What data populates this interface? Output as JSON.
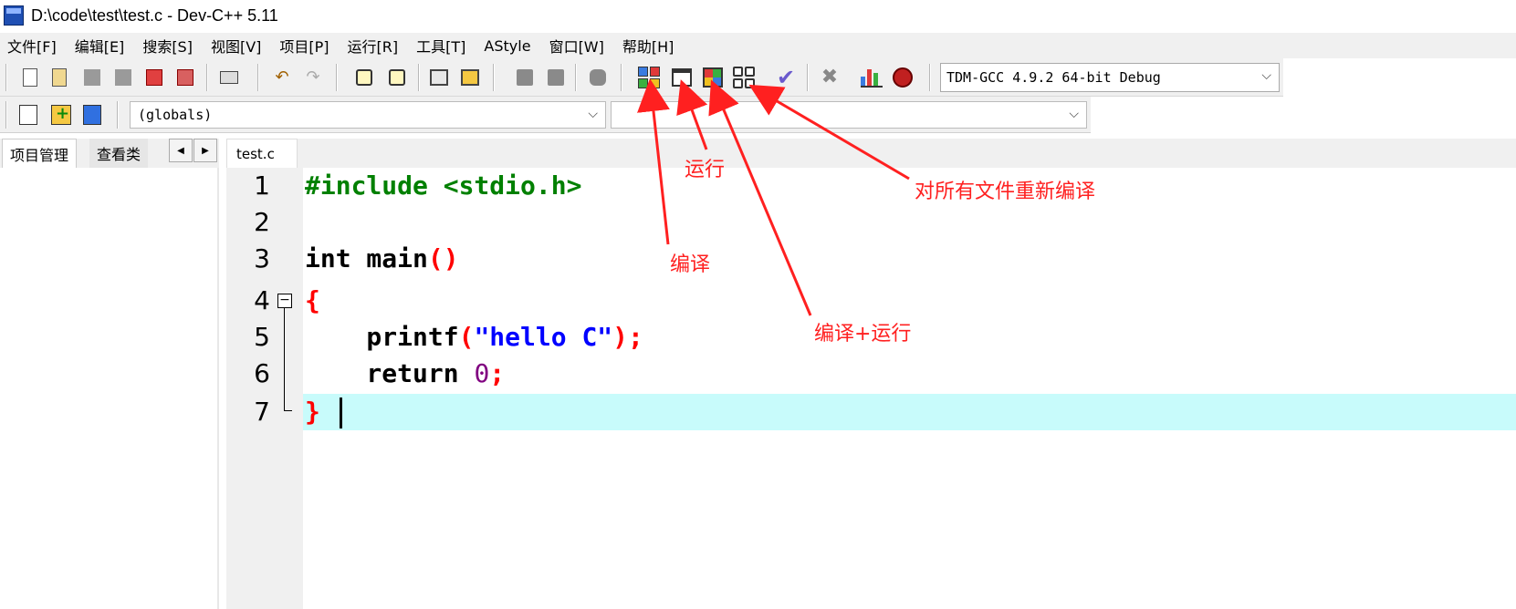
{
  "window": {
    "title": "D:\\code\\test\\test.c - Dev-C++ 5.11"
  },
  "menu": {
    "items": [
      "文件[F]",
      "编辑[E]",
      "搜索[S]",
      "视图[V]",
      "项目[P]",
      "运行[R]",
      "工具[T]",
      "AStyle",
      "窗口[W]",
      "帮助[H]"
    ]
  },
  "toolbar": {
    "compiler": "TDM-GCC 4.9.2 64-bit Debug",
    "scope": "(globals)",
    "icons": [
      "new-file-icon",
      "open-project-icon",
      "save-icon",
      "save-all-icon",
      "close-icon",
      "close-all-icon",
      "print-icon",
      "undo-icon",
      "redo-icon",
      "find-icon",
      "replace-icon",
      "toggle-panel-icon",
      "split-icon",
      "indent-icon",
      "unindent-icon",
      "comment-icon",
      "compile-icon",
      "run-icon",
      "compile-run-icon",
      "rebuild-all-icon",
      "syntax-check-icon",
      "stop-icon",
      "profile-icon",
      "debug-icon"
    ]
  },
  "left_panel": {
    "tabs": [
      "项目管理",
      "查看类"
    ]
  },
  "editor": {
    "file_tab": "test.c",
    "line_numbers": [
      "1",
      "2",
      "3",
      "4",
      "5",
      "6",
      "7"
    ],
    "code": {
      "l1": "#include <stdio.h>",
      "l3_kw": "int",
      "l3_fn": " main",
      "l3_paren": "()",
      "l4": "{",
      "l5_fn": "    printf",
      "l5_open": "(",
      "l5_str": "\"hello C\"",
      "l5_close": ");",
      "l6_kw": "    return ",
      "l6_num": "0",
      "l6_semi": ";",
      "l7": "}"
    }
  },
  "annotations": {
    "compile": "编译",
    "run": "运行",
    "compile_run": "编译+运行",
    "rebuild_all": "对所有文件重新编译"
  },
  "colors": {
    "annotation": "#ff2020",
    "current_line": "#c8fbfb",
    "preprocessor": "#008000",
    "string": "#0000ff",
    "brace": "#ff0000",
    "number": "#800080"
  }
}
